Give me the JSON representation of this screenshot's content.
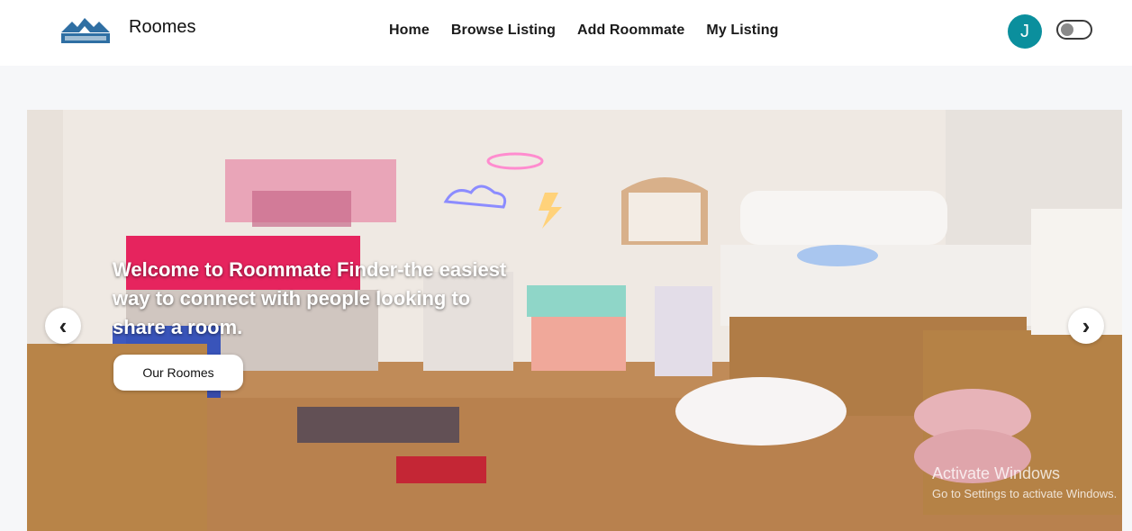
{
  "brand": {
    "logo_icon": "roommates-house-logo-icon",
    "name": "Roomes"
  },
  "nav": {
    "links": [
      "Home",
      "Browse Listing",
      "Add Roommate",
      "My Listing"
    ]
  },
  "user": {
    "avatar_initial": "J",
    "avatar_color": "#0b8f9d",
    "theme_toggle_icon": "toggle-switch-icon",
    "theme_toggle_on": false
  },
  "hero": {
    "background_icon": "dorm-room-photo",
    "headline": "Welcome to Roommate Finder-the easiest way to connect with people looking to share a room.",
    "cta_label": "Our Roomes",
    "prev_arrow": "‹",
    "next_arrow": "›"
  },
  "watermark": {
    "title": "Activate Windows",
    "subtitle": "Go to Settings to activate Windows."
  },
  "colors": {
    "page_bg": "#f6f7f9",
    "navbar_bg": "#ffffff",
    "avatar": "#0b8f9d"
  }
}
